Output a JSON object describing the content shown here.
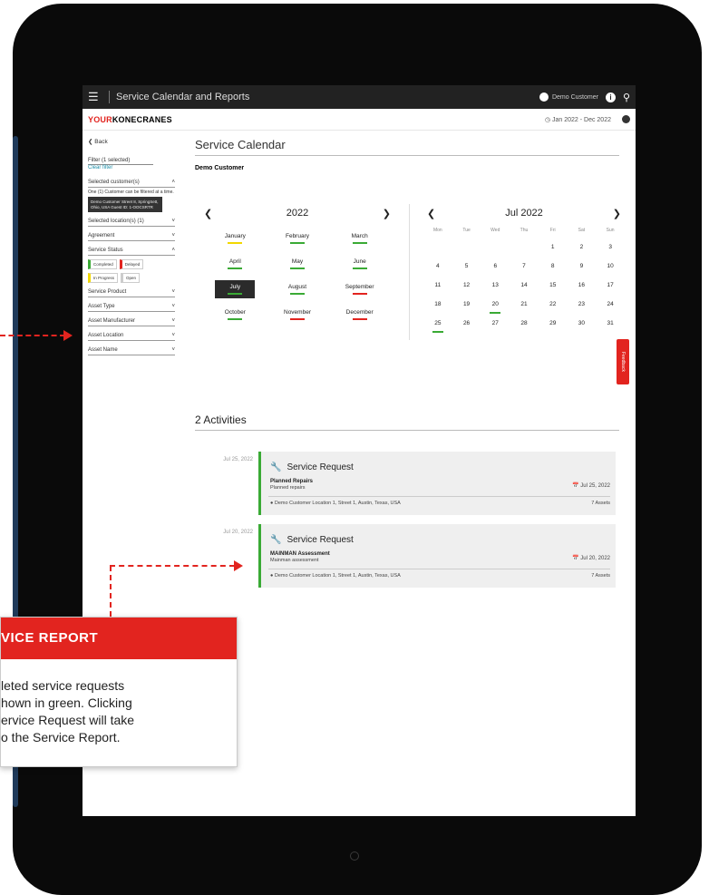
{
  "topbar": {
    "title": "Service Calendar and Reports",
    "customer": "Demo Customer"
  },
  "brand": {
    "logo_accent": "YOUR",
    "logo_rest": "KONECRANES",
    "date_range": "Jan 2022 - Dec 2022"
  },
  "sidebar": {
    "back": "Back",
    "filter": "Filter (1 selected)",
    "clear": "Clear filter",
    "selected_customers": "Selected customer(s)",
    "note": "One (1) Customer can be filtered at a time.",
    "customer_box": "Demo Customer Street 8, SpringSett, Ohio, USA Guest ID: 1-OOCSRTR",
    "selected_locations": "Selected location(s) (1)",
    "agreement": "Agreement",
    "service_status": "Service Status",
    "chip_completed": "Completed",
    "chip_delayed": "Delayed",
    "chip_inprogress": "In Progress",
    "chip_open": "Open",
    "service_product": "Service Product",
    "asset_type": "Asset Type",
    "asset_manufacturer": "Asset Manufacturer",
    "asset_location": "Asset Location",
    "asset_name": "Asset Name"
  },
  "main": {
    "title": "Service Calendar",
    "customer": "Demo Customer",
    "year": "2022",
    "month_title": "Jul 2022",
    "months": [
      {
        "name": "January",
        "status": "yellow"
      },
      {
        "name": "February",
        "status": "green"
      },
      {
        "name": "March",
        "status": "green"
      },
      {
        "name": "April",
        "status": "green"
      },
      {
        "name": "May",
        "status": "green"
      },
      {
        "name": "June",
        "status": "green"
      },
      {
        "name": "July",
        "status": "green",
        "selected": true
      },
      {
        "name": "August",
        "status": "green"
      },
      {
        "name": "September",
        "status": "red"
      },
      {
        "name": "October",
        "status": "green"
      },
      {
        "name": "November",
        "status": "red"
      },
      {
        "name": "December",
        "status": "red"
      }
    ],
    "weekdays": [
      "Mon",
      "Tue",
      "Wed",
      "Thu",
      "Fri",
      "Sat",
      "Sun"
    ],
    "days": [
      "",
      "",
      "",
      "",
      "1",
      "2",
      "3",
      "4",
      "5",
      "6",
      "7",
      "8",
      "9",
      "10",
      "11",
      "12",
      "13",
      "14",
      "15",
      "16",
      "17",
      "18",
      "19",
      "20",
      "21",
      "22",
      "23",
      "24",
      "25",
      "26",
      "27",
      "28",
      "29",
      "30",
      "31"
    ],
    "marked_days": [
      "20",
      "25"
    ],
    "activities_title": "2 Activities",
    "activities": [
      {
        "date": "Jul 25, 2022",
        "title": "Service Request",
        "kind": "Planned Repairs",
        "sub": "Planned repairs",
        "card_date": "Jul 25, 2022",
        "location": "Demo Customer Location 1, Street 1, Austin, Texas, USA",
        "assets": "7 Assets"
      },
      {
        "date": "Jul 20, 2022",
        "title": "Service Request",
        "kind": "MAINMAN Assessment",
        "sub": "Mainman assessment",
        "card_date": "Jul 20, 2022",
        "location": "Demo Customer Location 1, Street 1, Austin, Texas, USA",
        "assets": "7 Assets"
      }
    ],
    "feedback": "Feedback"
  },
  "callout": {
    "heading": "VICE REPORT",
    "body": "leted service requests\nhown in green. Clicking\nervice Request will take\no the Service Report."
  },
  "colors": {
    "accent_red": "#e2241f",
    "green": "#3aaa35",
    "yellow": "#f2d800"
  }
}
